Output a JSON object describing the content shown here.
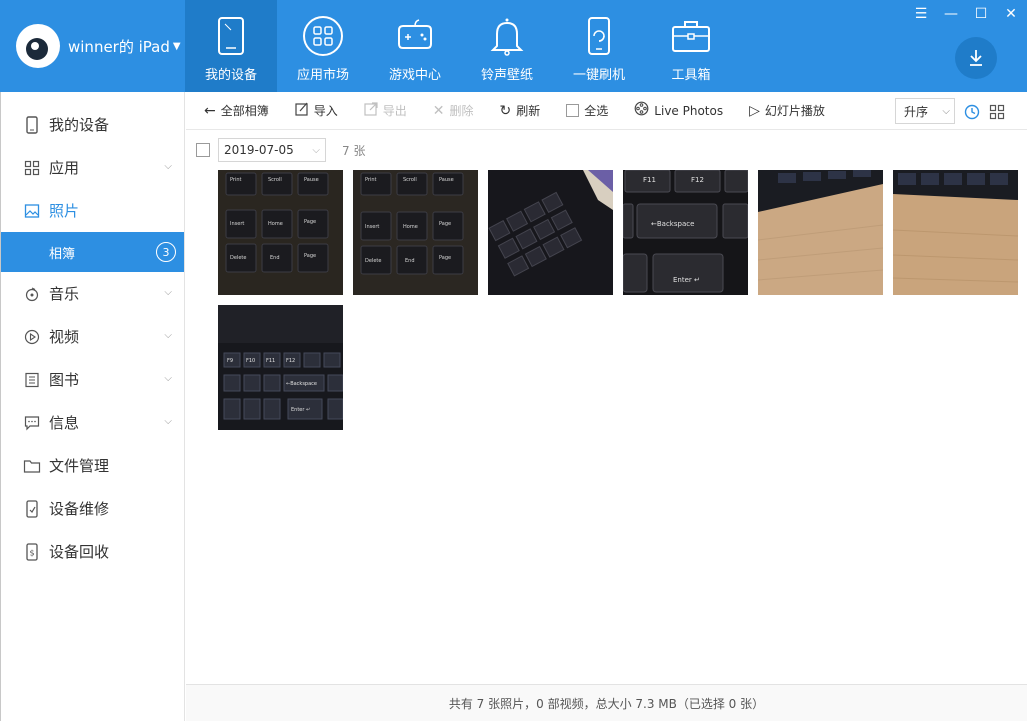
{
  "app": {
    "device_name": "winner的 iPad",
    "nav_tabs": [
      {
        "label": "我的设备",
        "icon": "tablet-icon"
      },
      {
        "label": "应用市场",
        "icon": "apps-grid-icon"
      },
      {
        "label": "游戏中心",
        "icon": "gamepad-icon"
      },
      {
        "label": "铃声壁纸",
        "icon": "bell-icon"
      },
      {
        "label": "一键刷机",
        "icon": "phone-refresh-icon"
      },
      {
        "label": "工具箱",
        "icon": "toolbox-icon"
      }
    ],
    "window_controls": {
      "menu": "☰",
      "minimize": "—",
      "maximize": "☐",
      "close": "✕"
    },
    "accent": "#2d8fe2"
  },
  "sidebar": {
    "items": [
      {
        "label": "我的设备",
        "icon": "device-icon"
      },
      {
        "label": "应用",
        "icon": "apps-icon"
      },
      {
        "label": "照片",
        "icon": "photo-icon"
      },
      {
        "label": "相簿",
        "count": "3"
      },
      {
        "label": "音乐",
        "icon": "music-icon"
      },
      {
        "label": "视频",
        "icon": "video-icon"
      },
      {
        "label": "图书",
        "icon": "book-icon"
      },
      {
        "label": "信息",
        "icon": "message-icon"
      },
      {
        "label": "文件管理",
        "icon": "folder-icon"
      },
      {
        "label": "设备维修",
        "icon": "repair-icon"
      },
      {
        "label": "设备回收",
        "icon": "recycle-icon"
      }
    ]
  },
  "toolbar": {
    "back_all_albums": "全部相簿",
    "import": "导入",
    "export": "导出",
    "delete": "删除",
    "refresh": "刷新",
    "select_all": "全选",
    "live_photos": "Live Photos",
    "slideshow": "幻灯片播放",
    "sort": "升序"
  },
  "group": {
    "date": "2019-07-05",
    "count": "7 张"
  },
  "photos": [
    {
      "desc": "keyboard-insert-home-keys"
    },
    {
      "desc": "keyboard-insert-home-keys-2"
    },
    {
      "desc": "keyboard-numpad-angle"
    },
    {
      "desc": "keyboard-backspace-enter"
    },
    {
      "desc": "keyboard-edge-wood-desk"
    },
    {
      "desc": "keyboard-edge-wood-desk-2"
    },
    {
      "desc": "keyboard-function-backspace"
    }
  ],
  "status": {
    "summary": "共有 7 张照片，0 部视频，总大小 7.3 MB（已选择 0 张）"
  }
}
